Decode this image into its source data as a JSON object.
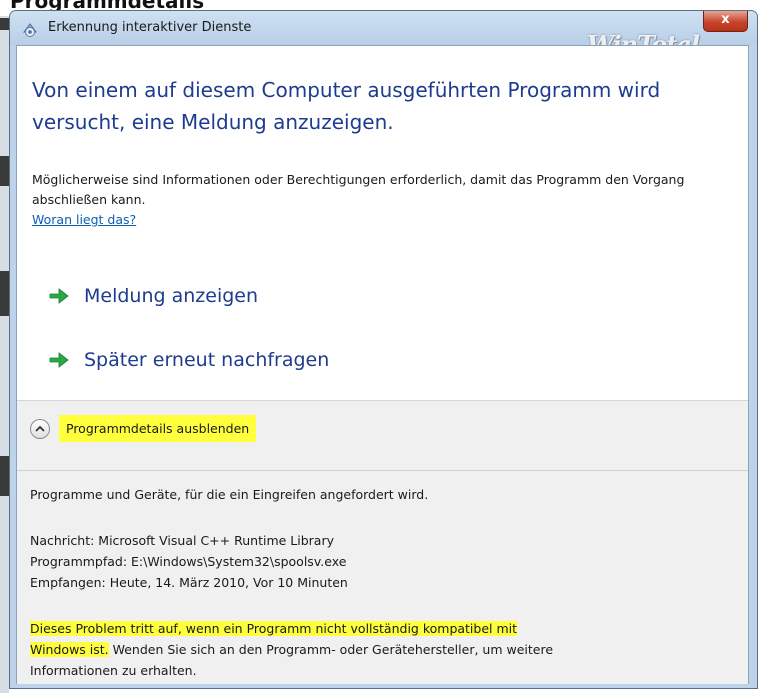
{
  "background_strip": {
    "text": "Programmdetails"
  },
  "window": {
    "title": "Erkennung interaktiver Dienste",
    "close_label": "x",
    "watermark": "WinTotal"
  },
  "main": {
    "headline": "Von einem auf diesem Computer ausgeführten Programm wird versucht, eine Meldung anzuzeigen.",
    "description": "Möglicherweise sind Informationen oder Berechtigungen erforderlich, damit das Programm den Vorgang abschließen kann.",
    "why_link": "Woran liegt das?",
    "commands": [
      {
        "label": "Meldung anzeigen"
      },
      {
        "label": "Später erneut nachfragen"
      }
    ]
  },
  "details": {
    "toggle_label": "Programmdetails ausblenden",
    "intro": "Programme und Geräte, für die ein Eingreifen angefordert wird.",
    "message_line": "Nachricht:  Microsoft Visual C++ Runtime Library",
    "path_line": "Programmpfad:  E:\\Windows\\System32\\spoolsv.exe",
    "received_line": "Empfangen:  Heute, 14. März 2010, Vor 10 Minuten",
    "problem_highlight_1": "Dieses Problem tritt auf, wenn ein Programm nicht vollständig kompatibel mit",
    "problem_highlight_2": "Windows ist.",
    "problem_rest": " Wenden Sie sich an den Programm- oder Gerätehersteller, um weitere",
    "problem_last": "Informationen zu erhalten."
  },
  "colors": {
    "accent_blue": "#1e3c8f",
    "link_blue": "#0b5fb5",
    "highlight_yellow": "#ffff3e",
    "arrow_green": "#2aa844",
    "close_red": "#c7452e"
  },
  "icons": {
    "title_icon": "interactive-services-icon",
    "command_icon": "green-arrow-icon",
    "toggle_icon": "chevron-up-icon"
  }
}
